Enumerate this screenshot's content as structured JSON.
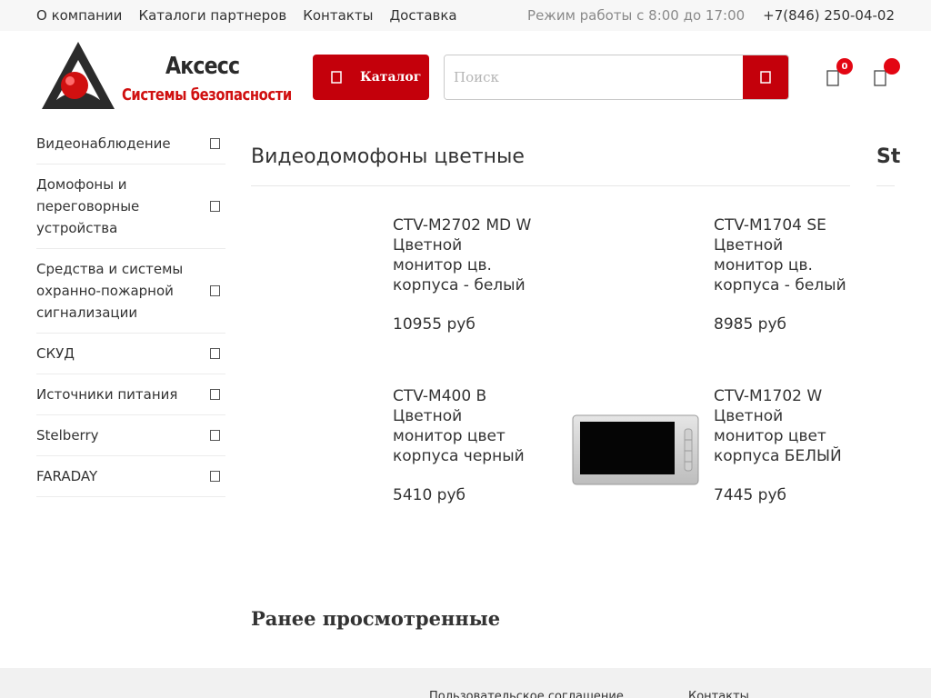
{
  "topbar": {
    "links": [
      "О компании",
      "Каталоги партнеров",
      "Контакты",
      "Доставка"
    ],
    "hours": "Режим работы с 8:00 до 17:00",
    "phone": "+7(846) 250-04-02"
  },
  "logo": {
    "brand": "Аксесс",
    "subtitle": "Системы безопасности"
  },
  "header": {
    "catalog_label": "Каталог",
    "search_placeholder": "Поиск",
    "favorites_count": "0"
  },
  "sidebar": {
    "items": [
      {
        "label": "Видеонаблюдение"
      },
      {
        "label": "Домофоны и переговорные устройства"
      },
      {
        "label": "Средства и системы охранно-пожарной сигнализации"
      },
      {
        "label": "СКУД"
      },
      {
        "label": "Источники питания"
      },
      {
        "label": "Stelberry"
      },
      {
        "label": "FARADAY"
      }
    ]
  },
  "main": {
    "section_title": "Видеодомофоны цветные",
    "next_section_title": "St",
    "products": [
      {
        "name": "CTV-M2702 MD W Цветной монитор цв. корпуса - белый",
        "price": "10955 руб"
      },
      {
        "name": "CTV-M1704 SE Цветной монитор цв. корпуса - белый",
        "price": "8985 руб"
      },
      {
        "name": "CTV-M400 B Цветной монитор цвет корпуса черный",
        "price": "5410 руб"
      },
      {
        "name": "CTV-M1702 W Цветной монитор цвет корпуса БЕЛЫЙ",
        "price": "7445 руб"
      }
    ],
    "recent_title": "Ранее просмотренные"
  },
  "footer": {
    "links": [
      "Пользовательское соглашение",
      "Контакты"
    ]
  },
  "colors": {
    "accent": "#c4000b",
    "badge": "#e30613"
  }
}
